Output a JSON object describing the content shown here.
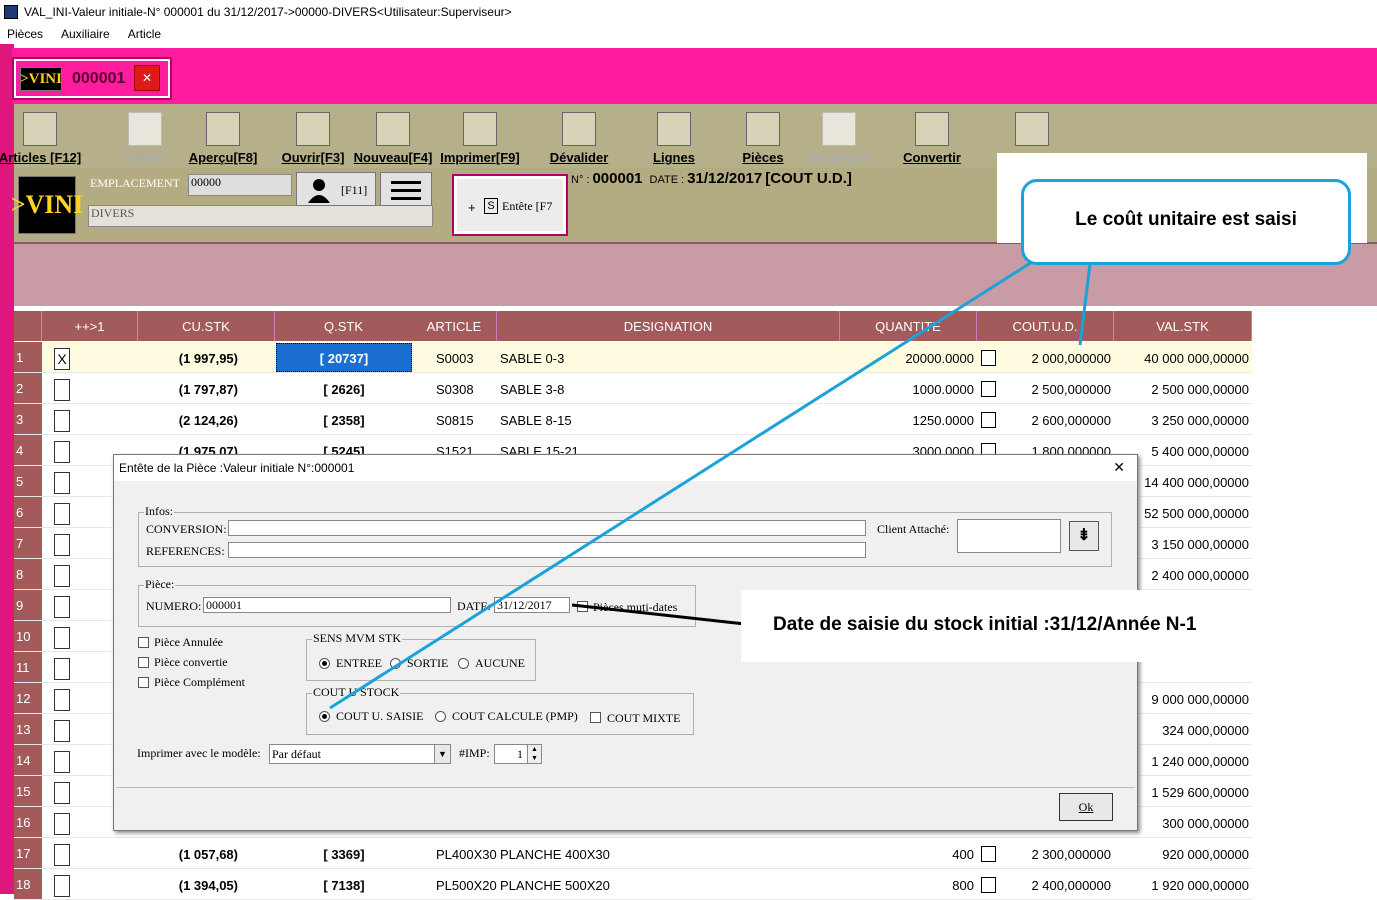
{
  "window": {
    "title": "VAL_INI-Valeur initiale-N° 000001 du 31/12/2017->00000-DIVERS<Utilisateur:Superviseur>"
  },
  "menu": [
    "Pièces",
    "Auxiliaire",
    "Article"
  ],
  "doc_tab": {
    "logo": ">VINI",
    "number": "000001"
  },
  "toolbar": [
    {
      "label": "Articles [F12]",
      "icon": "grid-icon",
      "enabled": true
    },
    {
      "label": "Valider",
      "icon": "validate-icon",
      "enabled": false
    },
    {
      "label": "Aperçu[F8]",
      "icon": "preview-icon",
      "enabled": true
    },
    {
      "label": "Ouvrir[F3]",
      "icon": "open-icon",
      "enabled": true
    },
    {
      "label": "Nouveau[F4]",
      "icon": "new-icon",
      "enabled": true
    },
    {
      "label": "Imprimer[F9]",
      "icon": "printer-icon",
      "enabled": true
    },
    {
      "label": "Dévalider",
      "icon": "unvalidate-icon",
      "enabled": true
    },
    {
      "label": "Lignes",
      "icon": "magnifier-icon",
      "enabled": true
    },
    {
      "label": "Pièces",
      "icon": "document-grid-icon",
      "enabled": true
    },
    {
      "label": "Supprimer",
      "icon": "delete-icon",
      "enabled": false
    },
    {
      "label": "Convertir",
      "icon": "convert-icon",
      "enabled": true
    },
    {
      "label": "",
      "icon": "list-icon",
      "enabled": true
    }
  ],
  "subbar": {
    "emplacement_label": "EMPLACEMENT",
    "emplacement_value": "00000",
    "emplacement_name": "DIVERS",
    "user_btn": "[F11]",
    "entete_btn": "Entête [F7",
    "doc_info_prefix": "N° :",
    "doc_number": "000001",
    "date_prefix": "DATE :",
    "date": "31/12/2017",
    "mode": "[COUT U.D.]"
  },
  "grid": {
    "columns": [
      "++>1",
      "CU.STK",
      "Q.STK",
      "ARTICLE",
      "DESIGNATION",
      "QUANTITE",
      "COUT.U.D.",
      "VAL.STK"
    ],
    "rows": [
      {
        "n": "1",
        "check": "X",
        "cu": "(1 997,95)",
        "q": "[ 20737]",
        "art": "S0003",
        "des": "SABLE 0-3",
        "qte": "20000.0000",
        "cout": "2 000,000000",
        "val": "40 000 000,00000"
      },
      {
        "n": "2",
        "check": "",
        "cu": "(1 797,87)",
        "q": "[ 2626]",
        "art": "S0308",
        "des": "SABLE 3-8",
        "qte": "1000.0000",
        "cout": "2 500,000000",
        "val": "2 500 000,00000"
      },
      {
        "n": "3",
        "check": "",
        "cu": "(2 124,26)",
        "q": "[ 2358]",
        "art": "S0815",
        "des": "SABLE 8-15",
        "qte": "1250.0000",
        "cout": "2 600,000000",
        "val": "3 250 000,00000"
      },
      {
        "n": "4",
        "check": "",
        "cu": "(1 975,07)",
        "q": "[ 5245]",
        "art": "S1521",
        "des": "SABLE 15-21",
        "qte": "3000.0000",
        "cout": "1 800,000000",
        "val": "5 400 000,00000"
      },
      {
        "n": "5",
        "check": "",
        "cu": "",
        "q": "",
        "art": "",
        "des": "",
        "qte": "",
        "cout": "",
        "val": "14 400 000,00000"
      },
      {
        "n": "6",
        "check": "",
        "cu": "",
        "q": "",
        "art": "",
        "des": "",
        "qte": "",
        "cout": "",
        "val": "52 500 000,00000"
      },
      {
        "n": "7",
        "check": "",
        "cu": "",
        "q": "",
        "art": "",
        "des": "",
        "qte": "",
        "cout": "",
        "val": "3 150 000,00000"
      },
      {
        "n": "8",
        "check": "",
        "cu": "",
        "q": "",
        "art": "",
        "des": "",
        "qte": "",
        "cout": "",
        "val": "2 400 000,00000"
      },
      {
        "n": "9",
        "check": "",
        "cu": "",
        "q": "",
        "art": "",
        "des": "",
        "qte": "",
        "cout": "",
        "val": ""
      },
      {
        "n": "10",
        "check": "",
        "cu": "",
        "q": "",
        "art": "",
        "des": "",
        "qte": "",
        "cout": "",
        "val": ""
      },
      {
        "n": "11",
        "check": "",
        "cu": "",
        "q": "",
        "art": "",
        "des": "",
        "qte": "",
        "cout": "",
        "val": ""
      },
      {
        "n": "12",
        "check": "",
        "cu": "",
        "q": "",
        "art": "",
        "des": "",
        "qte": "",
        "cout": "",
        "val": "9 000 000,00000"
      },
      {
        "n": "13",
        "check": "",
        "cu": "",
        "q": "",
        "art": "",
        "des": "",
        "qte": "",
        "cout": "",
        "val": "324 000,00000"
      },
      {
        "n": "14",
        "check": "",
        "cu": "",
        "q": "",
        "art": "",
        "des": "",
        "qte": "",
        "cout": "",
        "val": "1 240 000,00000"
      },
      {
        "n": "15",
        "check": "",
        "cu": "",
        "q": "",
        "art": "",
        "des": "",
        "qte": "",
        "cout": "",
        "val": "1 529 600,00000"
      },
      {
        "n": "16",
        "check": "",
        "cu": "",
        "q": "",
        "art": "",
        "des": "",
        "qte": "",
        "cout": "",
        "val": "300 000,00000"
      },
      {
        "n": "17",
        "check": "",
        "cu": "(1 057,68)",
        "q": "[ 3369]",
        "art": "PL400X30",
        "des": "PLANCHE 400X30",
        "qte": "400",
        "cout": "2 300,000000",
        "val": "920 000,00000"
      },
      {
        "n": "18",
        "check": "",
        "cu": "(1 394,05)",
        "q": "[ 7138]",
        "art": "PL500X20",
        "des": "PLANCHE 500X20",
        "qte": "800",
        "cout": "2 400,000000",
        "val": "1 920 000,00000"
      }
    ]
  },
  "dialog": {
    "title": "Entête de la Pièce :Valeur initiale N°:000001",
    "close": "✕",
    "infos_legend": "Infos:",
    "conversion_label": "CONVERSION:",
    "references_label": "REFERENCES:",
    "client_label": "Client Attaché:",
    "piece_legend": "Pièce:",
    "numero_label": "NUMERO:",
    "numero_value": "000001",
    "date_label": "DATE:",
    "date_value": "31/12/2017",
    "multi_dates": "Pièces muti-dates",
    "annulee": "Pièce Annulée",
    "convertie": "Pièce convertie",
    "complement": "Pièce Complément",
    "sens_legend": "SENS MVM STK",
    "sens_options": [
      "ENTREE",
      "SORTIE",
      "AUCUNE"
    ],
    "cout_legend": "COUT U STOCK",
    "cout_options": [
      "COUT U. SAISIE",
      "COUT CALCULE (PMP)"
    ],
    "cout_mixte": "COUT MIXTE",
    "modele_label": "Imprimer avec le modèle:",
    "modele_value": "Par défaut",
    "imp_label": "#IMP:",
    "imp_value": "1",
    "ok": "Ok"
  },
  "annotations": {
    "cout_note": "Le coût unitaire est saisi",
    "date_note": "Date de saisie du stock initial :31/12/Année N-1"
  },
  "colors": {
    "pink": "#ff1c9e",
    "header": "#a25a5a",
    "toolbar": "#b5b08a",
    "callout": "#1aa3d9"
  }
}
